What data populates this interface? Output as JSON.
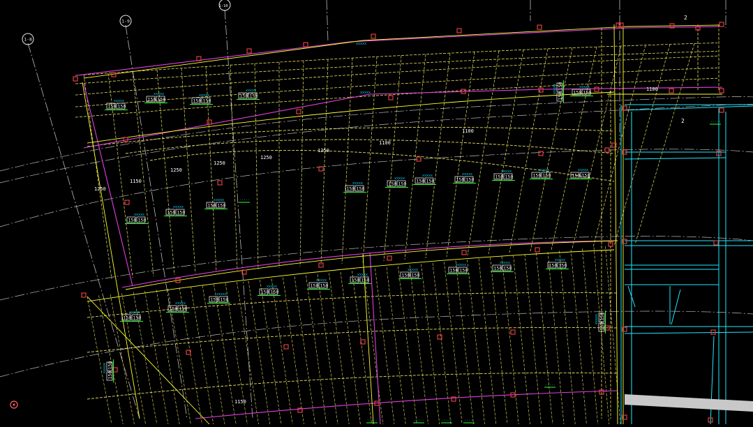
{
  "drawing": {
    "colors": {
      "background": "#000000",
      "beam_dashed": "#e8e060",
      "grid_line": "#bdbdbd",
      "magenta_line": "#e040e0",
      "yellow_line": "#ffff30",
      "cyan_line": "#20e8ff",
      "column_marker": "#e04040",
      "label_underline": "#2cff2c",
      "label_code": "#00d8ff",
      "wall_band": "#c8c8c8"
    },
    "grid_bubbles": [
      {
        "id": "grid-bubble-1-8",
        "label": "1-8"
      },
      {
        "id": "grid-bubble-1-9",
        "label": "1-9"
      },
      {
        "id": "grid-bubble-1-10",
        "label": "1-10"
      }
    ],
    "top_code_labels": [
      "xxxxx",
      "xxxxx"
    ],
    "room_labels": [
      "2",
      "2"
    ],
    "dimension_texts": [
      "1250",
      "1150",
      "1250",
      "1250",
      "1250",
      "1250",
      "1100",
      "1100",
      "1100",
      "1150"
    ],
    "upper_tags": [
      {
        "code": "xxxxx",
        "left": "150",
        "right": "150"
      },
      {
        "code": "xxxxx",
        "left": "150",
        "right": "150"
      },
      {
        "code": "xxxxx",
        "left": "150",
        "right": "150"
      },
      {
        "code": "xxxxx",
        "left": "150",
        "right": "150"
      }
    ],
    "mid_tags": [
      {
        "code": "xxxxx",
        "left": "150",
        "right": "150"
      },
      {
        "code": "xxxxx",
        "left": "150",
        "right": "150"
      },
      {
        "code": "xxxxx",
        "left": "150",
        "right": "150"
      },
      {
        "code": "xxxxx",
        "left": "150",
        "right": "150"
      },
      {
        "code": "xxxxx",
        "left": "150",
        "right": "150"
      },
      {
        "code": "xxxxx",
        "left": "150",
        "right": "150"
      },
      {
        "code": "xxxxx",
        "left": "150",
        "right": "150"
      },
      {
        "code": "xxxxx",
        "left": "150",
        "right": "150"
      },
      {
        "code": "xxxxx",
        "left": "150",
        "right": "150"
      }
    ],
    "lower_tags": [
      {
        "code": "xxxxx",
        "left": "150",
        "right": "150"
      },
      {
        "code": "xxxxx",
        "left": "150",
        "right": "150"
      },
      {
        "code": "xxxxx",
        "left": "150",
        "right": "150"
      },
      {
        "code": "xxxxx",
        "left": "150",
        "right": "150"
      },
      {
        "code": "xxxxx",
        "left": "150",
        "right": "150"
      },
      {
        "code": "xxxxx",
        "left": "150",
        "right": "150"
      },
      {
        "code": "xxxxx",
        "left": "150",
        "right": "150"
      },
      {
        "code": "xxxxx",
        "left": "150",
        "right": "150"
      },
      {
        "code": "xxxxx",
        "left": "150",
        "right": "150"
      },
      {
        "code": "xxxxx",
        "left": "150",
        "right": "150"
      },
      {
        "code": "xxxxx",
        "left": "150",
        "right": "150"
      },
      {
        "code": "xxxxx",
        "left": "150",
        "right": "150"
      }
    ],
    "vertical_tags": [
      {
        "code": "xxxxx",
        "left": "150",
        "right": "150"
      },
      {
        "code": "xxxxx",
        "left": "150",
        "right": "150"
      },
      {
        "code": "xxxxx",
        "left": "150",
        "right": "150"
      }
    ]
  }
}
